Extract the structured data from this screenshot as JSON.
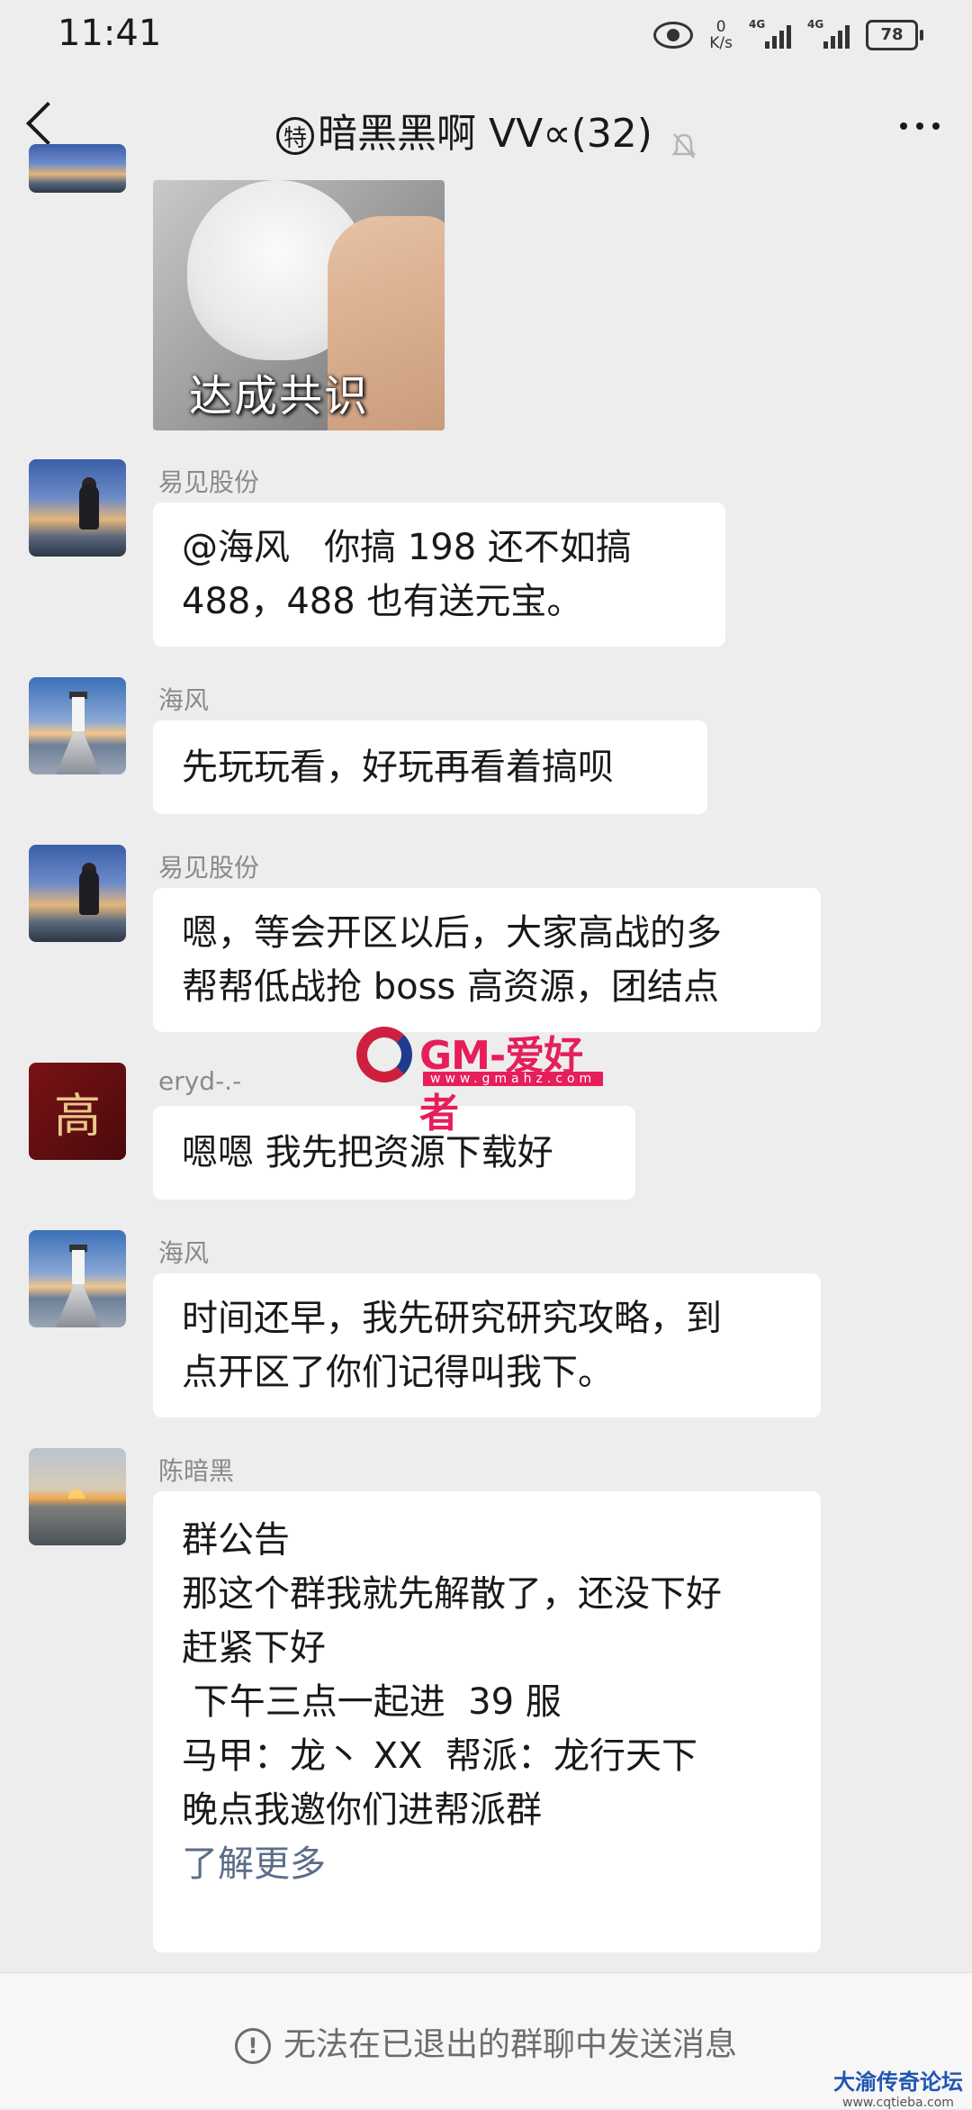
{
  "status_bar": {
    "time": "11:41",
    "speed_value": "0",
    "speed_unit": "K/s",
    "network1": "4G",
    "network2": "4G",
    "battery": "78"
  },
  "header": {
    "special_badge": "特",
    "title": "暗黑黑啊 VV∝(32)"
  },
  "sticker": {
    "caption": "达成共识"
  },
  "messages": [
    {
      "sender": "易见股份",
      "text": "@海风   你搞 198 还不如搞\n488，488 也有送元宝。"
    },
    {
      "sender": "海风",
      "text": "先玩玩看，好玩再看着搞呗"
    },
    {
      "sender": "易见股份",
      "text": "嗯，等会开区以后，大家高战的多\n帮帮低战抢 boss 高资源，团结点"
    },
    {
      "sender": "eryd-.-",
      "avatar_char": "高",
      "text": "嗯嗯 我先把资源下载好"
    },
    {
      "sender": "海风",
      "text": "时间还早，我先研究研究攻略，到\n点开区了你们记得叫我下。"
    },
    {
      "sender": "陈暗黑",
      "text": "群公告\n那这个群我就先解散了，还没下好\n赶紧下好\n 下午三点一起进  39 服\n马甲：龙丶 XX  帮派：龙行天下\n晚点我邀你们进帮派群\n",
      "more": "了解更多"
    }
  ],
  "footer": {
    "notice": "无法在已退出的群聊中发送消息"
  },
  "watermarks": {
    "main": "GM-爱好者",
    "main_url": "www.gmahz.com",
    "corner": "大渝传奇论坛",
    "corner_url": "www.cqtieba.com"
  }
}
